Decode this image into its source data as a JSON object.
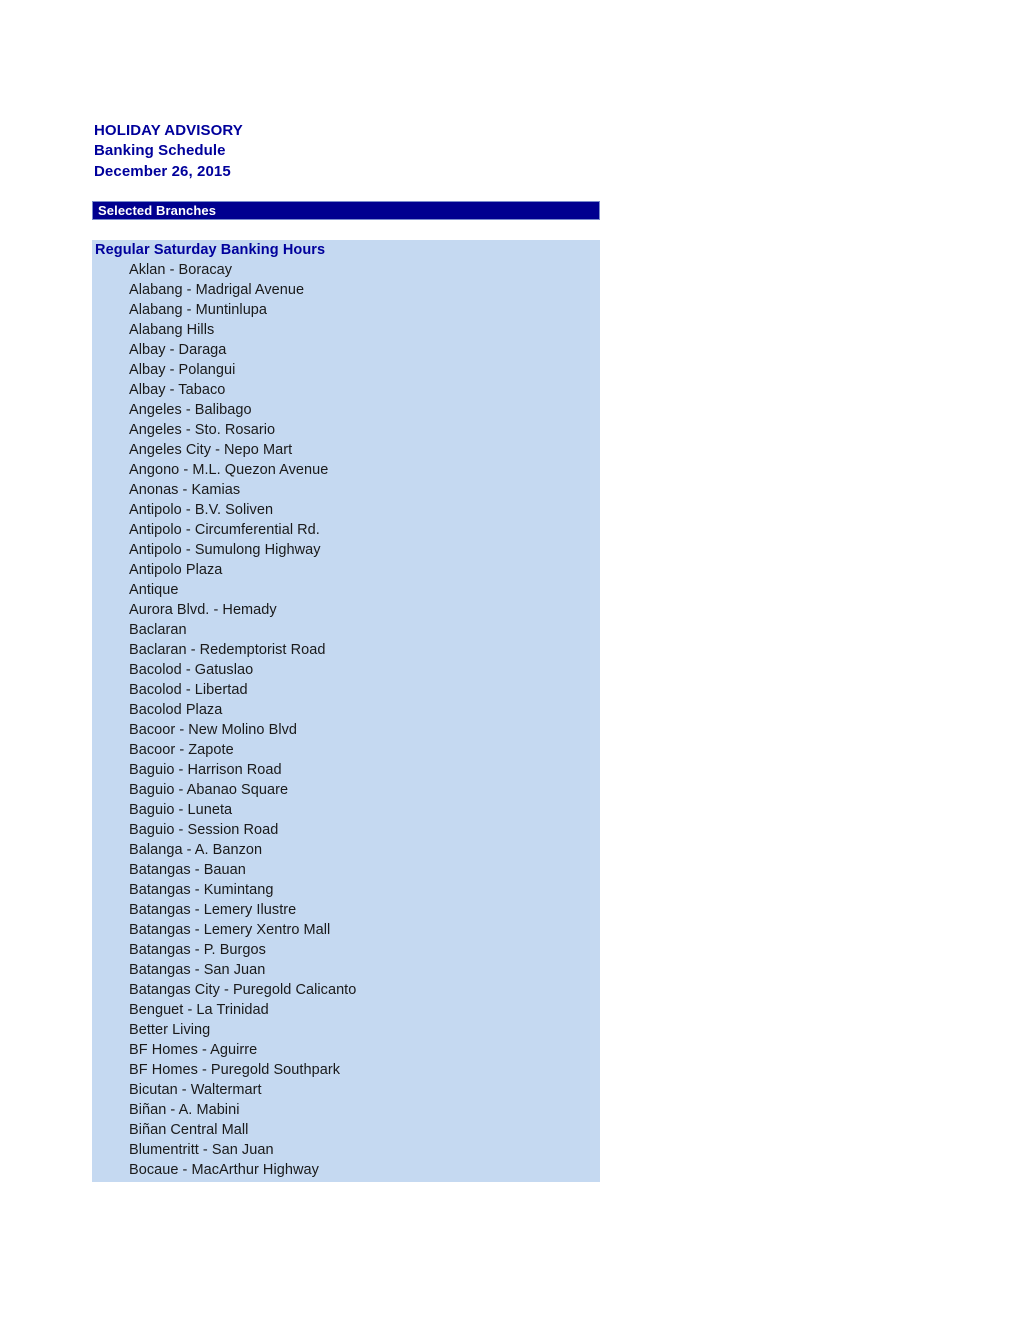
{
  "document": {
    "title_lines": [
      "HOLIDAY ADVISORY",
      "Banking Schedule",
      "December 26, 2015"
    ],
    "title_line_1": "HOLIDAY ADVISORY",
    "title_line_2": "Banking Schedule",
    "title_line_3": "December 26, 2015"
  },
  "section": {
    "bar_label": "Selected Branches"
  },
  "branch_group": {
    "heading": "Regular Saturday Banking Hours",
    "branches": [
      "Aklan - Boracay",
      "Alabang - Madrigal Avenue",
      "Alabang - Muntinlupa",
      "Alabang Hills",
      "Albay - Daraga",
      "Albay - Polangui",
      "Albay - Tabaco",
      "Angeles - Balibago",
      "Angeles - Sto. Rosario",
      "Angeles City - Nepo Mart",
      "Angono - M.L. Quezon Avenue",
      "Anonas - Kamias",
      "Antipolo - B.V. Soliven",
      "Antipolo - Circumferential Rd.",
      "Antipolo - Sumulong Highway",
      "Antipolo Plaza",
      "Antique",
      "Aurora Blvd. - Hemady",
      "Baclaran",
      "Baclaran - Redemptorist Road",
      "Bacolod - Gatuslao",
      "Bacolod - Libertad",
      "Bacolod Plaza",
      "Bacoor - New Molino Blvd",
      "Bacoor - Zapote",
      "Baguio - Harrison Road",
      "Baguio - Abanao Square",
      "Baguio - Luneta",
      "Baguio - Session Road",
      "Balanga - A. Banzon",
      "Batangas - Bauan",
      "Batangas - Kumintang",
      "Batangas - Lemery Ilustre",
      "Batangas - Lemery Xentro Mall",
      "Batangas - P. Burgos",
      "Batangas - San Juan",
      "Batangas City - Puregold Calicanto",
      "Benguet - La Trinidad",
      "Better Living",
      "BF Homes - Aguirre",
      "BF Homes - Puregold Southpark",
      "Bicutan - Waltermart",
      "Biñan - A. Mabini",
      "Biñan Central Mall",
      "Blumentritt - San Juan",
      "Bocaue - MacArthur Highway"
    ]
  },
  "colors": {
    "heading_blue": "#00009b",
    "section_bar_navy": "#00008f",
    "section_bar_border": "#7a8ccc",
    "panel_light_blue": "#c5d9f1",
    "body_text": "#1a1a1a",
    "page_background": "#ffffff"
  }
}
